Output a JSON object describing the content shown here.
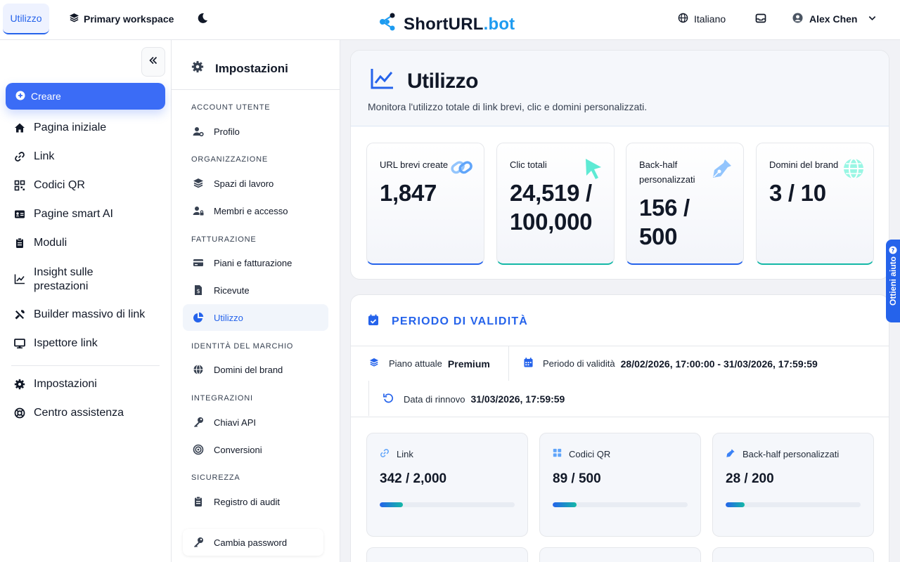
{
  "topbar": {
    "tab": "Utilizzo",
    "workspace": "Primary workspace",
    "logo_a": "ShortURL",
    "logo_b": ".bot",
    "language": "Italiano",
    "user": "Alex Chen"
  },
  "sidebar": {
    "create": "Creare",
    "items": [
      {
        "label": "Pagina iniziale",
        "icon": "home-icon"
      },
      {
        "label": "Link",
        "icon": "link-icon"
      },
      {
        "label": "Codici QR",
        "icon": "qr-icon"
      },
      {
        "label": "Pagine smart AI",
        "icon": "id-card-icon"
      },
      {
        "label": "Moduli",
        "icon": "clipboard-icon"
      },
      {
        "label": "Insight sulle prestazioni",
        "icon": "chart-line-icon"
      },
      {
        "label": "Builder massivo di link",
        "icon": "tools-icon"
      },
      {
        "label": "Ispettore link",
        "icon": "monitor-icon"
      },
      {
        "label": "Impostazioni",
        "icon": "gear-icon"
      },
      {
        "label": "Centro assistenza",
        "icon": "lifebuoy-icon"
      }
    ]
  },
  "settings": {
    "title": "Impostazioni",
    "sections": [
      "ACCOUNT UTENTE",
      "ORGANIZZAZIONE",
      "FATTURAZIONE",
      "IDENTITÀ DEL MARCHIO",
      "INTEGRAZIONI",
      "SICUREZZA"
    ],
    "items": [
      "Profilo",
      "Spazi di lavoro",
      "Membri e accesso",
      "Piani e fatturazione",
      "Ricevute",
      "Utilizzo",
      "Domini del brand",
      "Chiavi API",
      "Conversioni",
      "Registro di audit",
      "Cambia password"
    ]
  },
  "usage": {
    "title": "Utilizzo",
    "subtitle": "Monitora l'utilizzo totale di link brevi, clic e domini personalizzati.",
    "stats": [
      {
        "label": "URL brevi create",
        "value": "1,847"
      },
      {
        "label": "Clic totali",
        "value_a": "24,519 /",
        "value_b": "100,000"
      },
      {
        "label": "Back-half personalizzati",
        "value_a": "156 /",
        "value_b": "500"
      },
      {
        "label": "Domini del brand",
        "value": "3 / 10"
      }
    ]
  },
  "validity": {
    "title": "PERIODO DI VALIDITÀ",
    "plan_label": "Piano attuale",
    "plan_value": "Premium",
    "period_label": "Periodo di validità",
    "period_value": "28/02/2026, 17:00:00 - 31/03/2026, 17:59:59",
    "renewal_label": "Data di rinnovo",
    "renewal_value": "31/03/2026, 17:59:59",
    "quotas": [
      {
        "label": "Link",
        "value": "342 / 2,000",
        "fraction": 0.171
      },
      {
        "label": "Codici QR",
        "value": "89 / 500",
        "fraction": 0.178
      },
      {
        "label": "Back-half personalizzati",
        "value": "28 / 200",
        "fraction": 0.14
      }
    ]
  },
  "help": "Ottieni aiuto",
  "colors": {
    "accent": "#2563eb",
    "teal": "#14b8a6",
    "logo_blue": "#1d9bf0"
  }
}
